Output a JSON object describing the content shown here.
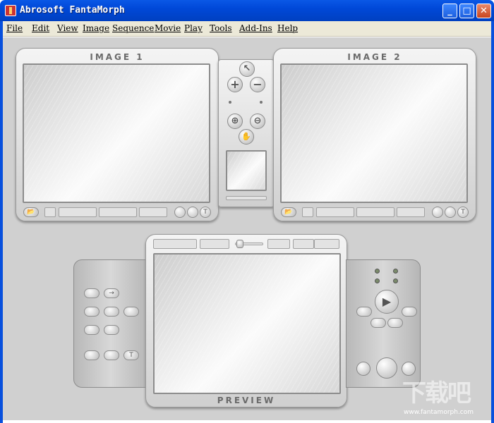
{
  "window": {
    "title": "Abrosoft FantaMorph",
    "minimize": "_",
    "maximize": "□",
    "close": "✕"
  },
  "menu": [
    "File",
    "Edit",
    "View",
    "Image",
    "Sequence",
    "Movie",
    "Play",
    "Tools",
    "Add-Ins",
    "Help"
  ],
  "image1": {
    "title": "IMAGE 1"
  },
  "image2": {
    "title": "IMAGE 2"
  },
  "preview": {
    "title": "PREVIEW"
  },
  "icons": {
    "open": "open-folder-icon",
    "pointer": "pointer-icon",
    "add": "plus-icon",
    "remove": "minus-icon",
    "zoom_in": "zoom-in-icon",
    "zoom_out": "zoom-out-icon",
    "hand": "hand-icon",
    "play": "play-icon"
  },
  "glyphs": {
    "plus": "+",
    "minus": "−",
    "play": "▶",
    "text": "T",
    "arrow": "→",
    "pointer": "↖",
    "zoom": "⊕",
    "zoom_out": "⊖",
    "hand": "✋",
    "open": "📂",
    "loop": "⇄",
    "first": "|◀",
    "last": "▶|",
    "prev": "◀|",
    "next": "|▶"
  },
  "watermark": {
    "url": "www.fantamorph.com",
    "logo": "下载吧"
  }
}
